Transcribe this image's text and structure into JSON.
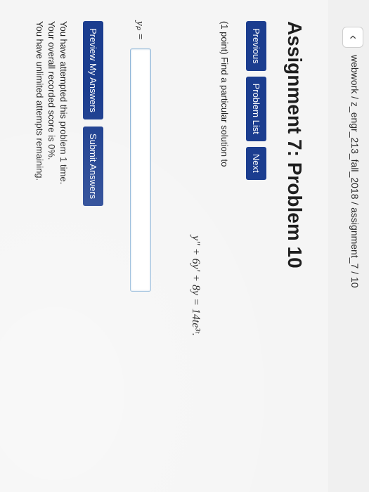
{
  "breadcrumb": "webwork / z_engr_213_fall_2018 / assignment_7 / 10",
  "back_icon": "chevron-left-icon",
  "page_title": "Assignment 7: Problem 10",
  "nav": {
    "previous": "Previous",
    "problem_list": "Problem List",
    "next": "Next"
  },
  "problem": {
    "prompt": "(1 point) Find a particular solution to",
    "equation": "y″ + 6y′ + 8y = 14te³ᵗ.",
    "answer_label": "yₚ =",
    "answer_value": ""
  },
  "actions": {
    "preview": "Preview My Answers",
    "submit": "Submit Answers"
  },
  "status": {
    "attempts": "You have attempted this problem 1 time.",
    "score": "Your overall recorded score is 0%.",
    "remaining": "You have unlimited attempts remaining."
  },
  "colors": {
    "button_blue": "#1b3d8f",
    "input_border": "#8fb6d8"
  }
}
